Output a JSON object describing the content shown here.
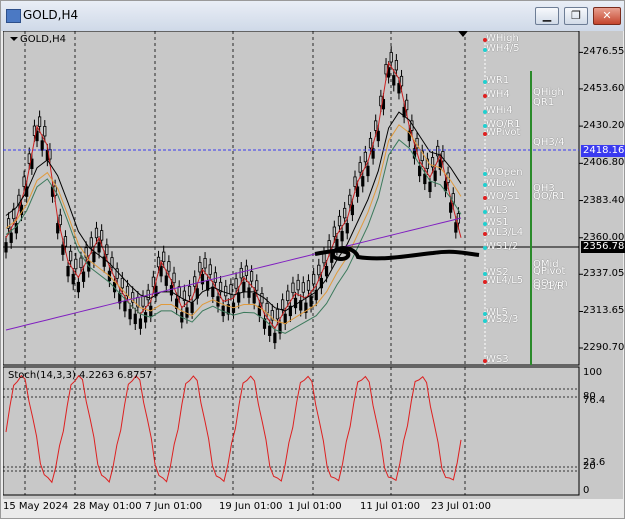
{
  "window": {
    "title": "GOLD,H4",
    "chart_title": "GOLD,H4",
    "min_label": "▁",
    "restore_label": "❐",
    "close_label": "✕"
  },
  "colors": {
    "bg": "#c8c8c8",
    "grid": "#000000",
    "bull": "#000000",
    "bear": "#000000",
    "ma_red": "#cc2020",
    "ma_orange": "#e09a3c",
    "ma_black": "#000000",
    "ma_green": "#3c7a5c",
    "ma_purple": "#8020c0",
    "stoch": "#dd2020",
    "current_price_bg": "#000000",
    "hline_price_bg": "#3a3af0"
  },
  "price_axis": [
    "2476.55",
    "2453.60",
    "2430.20",
    "2406.80",
    "2383.40",
    "2360.00",
    "2337.05",
    "2313.65",
    "2290.70"
  ],
  "current_price": "2356.78",
  "marker_price": "2418.16",
  "stoch_label": "Stoch(14,3,3) 4.2263 6.8757",
  "stoch_axis": [
    "100",
    "80",
    "76.4",
    "23.6",
    "20",
    "0"
  ],
  "time_axis": [
    "15 May 2024",
    "28 May 01:00",
    "7 Jun 01:00",
    "19 Jun 01:00",
    "1 Jul 01:00",
    "11 Jul 01:00",
    "23 Jul 01:00"
  ],
  "levels_left": [
    "WHigh",
    "WH4/5",
    "WR1",
    "WH4",
    "WHi4",
    "WO/R1",
    "WPivot",
    "WOpen",
    "WLow",
    "WO/S1",
    "WL3",
    "WS1",
    "WL3/L4",
    "WS1/2",
    "WS2",
    "WL4/L5",
    "WL5",
    "WS2/3",
    "WS3"
  ],
  "levels_right": [
    "QHigh",
    "QR1",
    "QH3/4",
    "QH3",
    "QO/R1",
    "QMid",
    "QPivot",
    "QOpen",
    "QS1/R"
  ],
  "chart_data": {
    "type": "line",
    "series": [
      {
        "values": [
          2360,
          2372,
          2395,
          2430,
          2418,
          2372,
          2345,
          2335,
          2348,
          2360,
          2342,
          2328,
          2318,
          2312,
          2320,
          2345,
          2333,
          2316,
          2322,
          2340,
          2332,
          2320,
          2322,
          2335,
          2328,
          2312,
          2303,
          2315,
          2325,
          2322,
          2330,
          2345,
          2362,
          2372,
          2395,
          2408,
          2430,
          2470,
          2460,
          2430,
          2408,
          2398,
          2412,
          2385,
          2360
        ]
      },
      {
        "values": [
          2370,
          2375,
          2385,
          2400,
          2405,
          2395,
          2378,
          2360,
          2350,
          2345,
          2340,
          2333,
          2326,
          2320,
          2318,
          2322,
          2322,
          2318,
          2315,
          2322,
          2325,
          2322,
          2320,
          2322,
          2322,
          2318,
          2312,
          2310,
          2314,
          2318,
          2322,
          2330,
          2342,
          2352,
          2366,
          2380,
          2398,
          2425,
          2435,
          2430,
          2420,
          2410,
          2408,
          2400,
          2390
        ]
      }
    ],
    "ylim": [
      2280,
      2490
    ]
  }
}
